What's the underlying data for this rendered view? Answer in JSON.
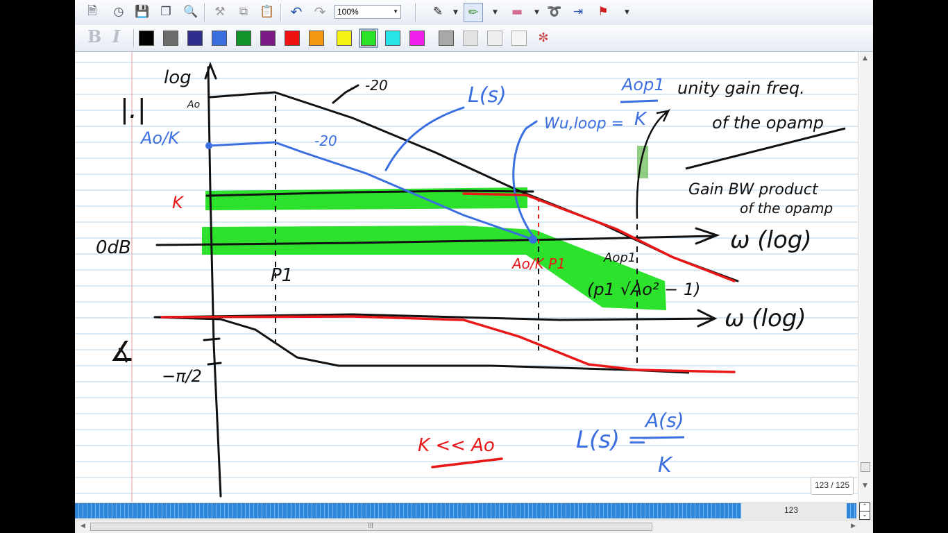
{
  "toolbar": {
    "zoom_value": "100%",
    "tools": [
      "new-page-icon",
      "history-icon",
      "save-icon",
      "copy-page-icon",
      "find-icon",
      "tool-icon",
      "copy-icon",
      "paste-icon",
      "undo-icon",
      "redo-icon"
    ],
    "pen_tools": [
      "pen-icon",
      "highlighter-icon",
      "eraser-icon",
      "lasso-icon",
      "insert-space-icon",
      "flag-icon"
    ]
  },
  "format": {
    "bold_label": "B",
    "italic_label": "I"
  },
  "palette": [
    "#000000",
    "#6b6b6b",
    "#2e2e8c",
    "#3a6fe0",
    "#12932b",
    "#7d1a86",
    "#ee1212",
    "#f39a12",
    "#f5f214",
    "#29e229",
    "#27e5e9",
    "#ef1fe9",
    "#a8a8a8",
    "#e3e3e3",
    "#eeeeee",
    "#f5f5f5"
  ],
  "notes": {
    "log_ao": "log",
    "ao_sub": "Ao",
    "slope1": "-20",
    "slope2": "-20",
    "l_of_s": "L(s)",
    "ao_k": "Ao/K",
    "w_u_loop": "Wu,loop =",
    "frac_num": "Aop1",
    "frac_den": "K",
    "unity_gain": "unity gain freq.",
    "of_opamp": "of the opamp",
    "gain_bw": "Gain BW product",
    "of_opamp2": "of the opamp",
    "k_label": "K",
    "odb": "0dB",
    "w_log1": "ω (log)",
    "p1": "P1",
    "ao_k_p1": "Ao/K P1",
    "aop1": "Aop1",
    "p1_sqrt": "(p1 √Ao² − 1)",
    "w_log2": "ω (log)",
    "angle": "∡",
    "neg_pi2": "−π/2",
    "k_ll_ao": "K << Ao",
    "ls_eq": "L(s) =",
    "as_num": "A(s)",
    "as_den": "K"
  },
  "pager": {
    "label": "123 / 125"
  },
  "nav": {
    "page_number": "123"
  }
}
